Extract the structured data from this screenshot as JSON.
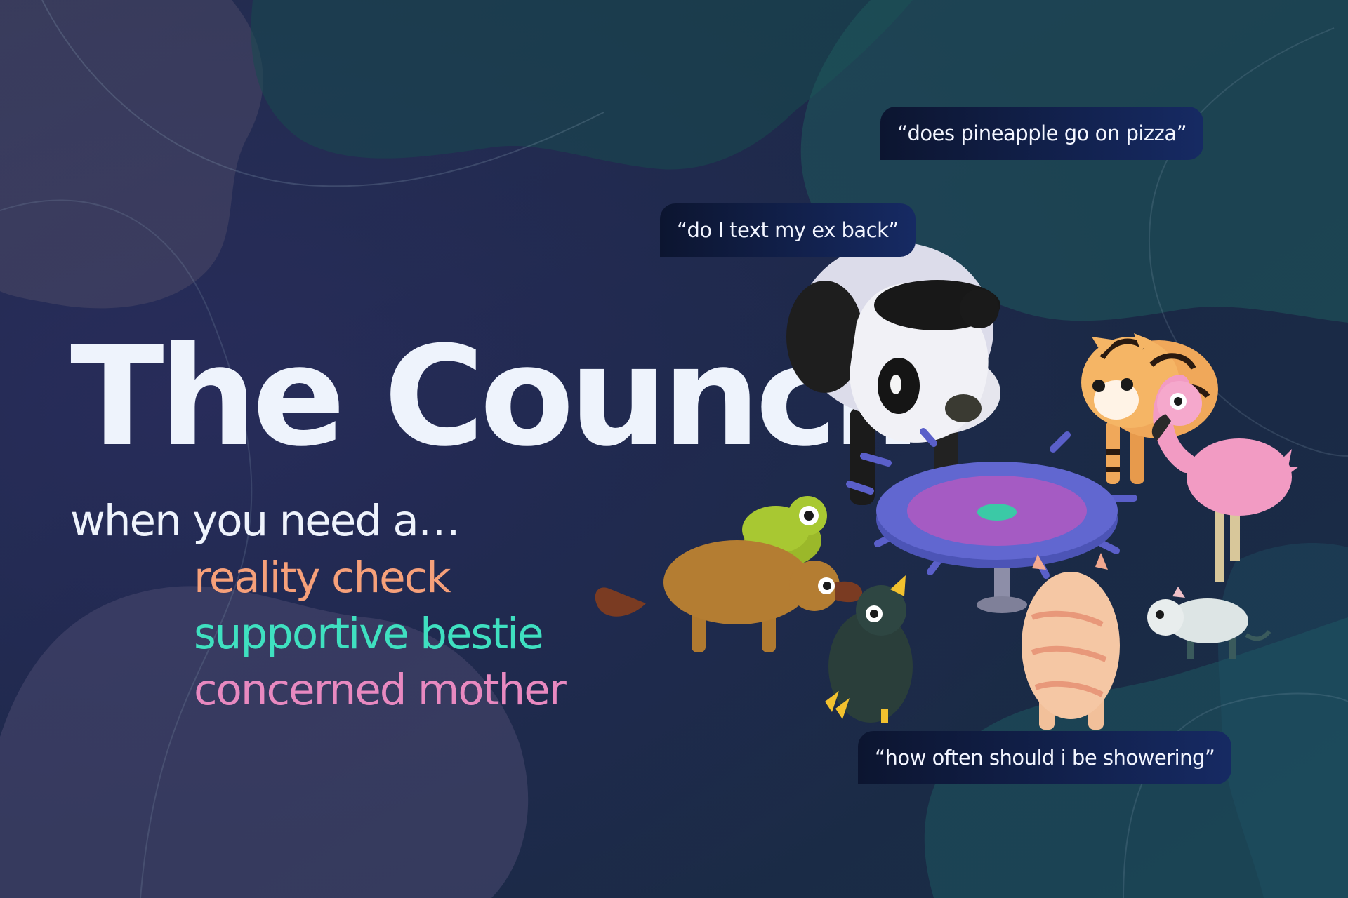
{
  "title": "The Council",
  "subtitle": "when you need a…",
  "roles": [
    {
      "label": "reality check",
      "color": "#f6a07a"
    },
    {
      "label": "supportive bestie",
      "color": "#3fe0c0"
    },
    {
      "label": "concerned mother",
      "color": "#e889c0"
    }
  ],
  "bubbles": [
    {
      "text": "“does pineapple go on pizza”"
    },
    {
      "text": "“do I text my ex back”"
    },
    {
      "text": "“how often should i be showering”"
    }
  ],
  "colors": {
    "background": "#1d2b45",
    "text": "#eef3fc",
    "bubble": "#0f1d45"
  }
}
